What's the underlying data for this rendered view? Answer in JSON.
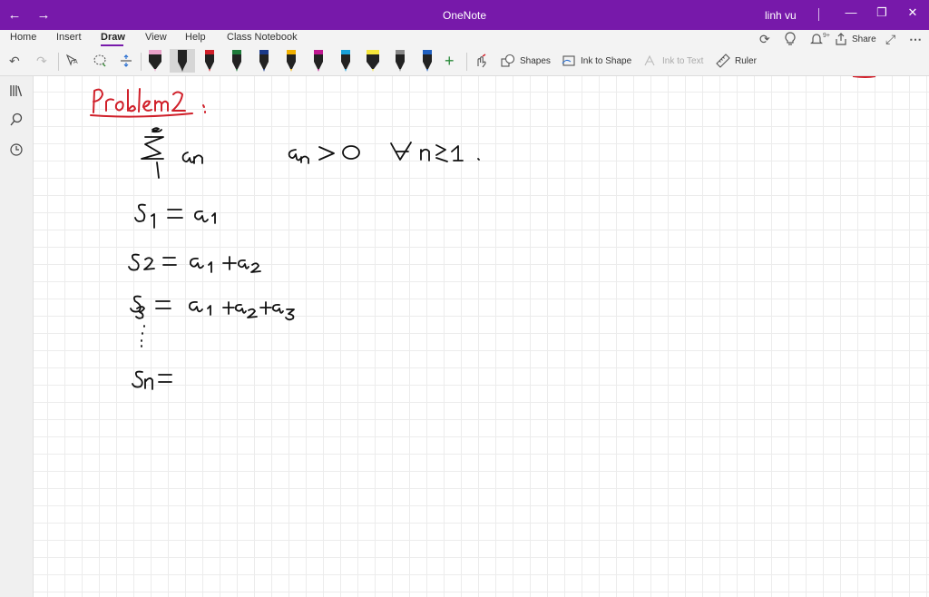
{
  "window": {
    "title": "OneNote",
    "user": "linh vu"
  },
  "ribbon": {
    "tabs": [
      "Home",
      "Insert",
      "Draw",
      "View",
      "Help",
      "Class Notebook"
    ],
    "active_tab": "Draw",
    "tools": {
      "shapes": "Shapes",
      "ink_to_shape": "Ink to Shape",
      "ink_to_text": "Ink to Text",
      "ruler": "Ruler"
    },
    "share": "Share",
    "notifications_count": "9+",
    "pens": [
      {
        "name": "pink-highlighter",
        "color": "#e8a0c8"
      },
      {
        "name": "black-pen",
        "color": "#222222"
      },
      {
        "name": "red-pen",
        "color": "#d0202a"
      },
      {
        "name": "green-pen",
        "color": "#1e7a3a"
      },
      {
        "name": "dark-blue-pen",
        "color": "#1a3a8a"
      },
      {
        "name": "yellow-pen",
        "color": "#f0b000"
      },
      {
        "name": "magenta-pen",
        "color": "#c01890"
      },
      {
        "name": "cyan-pen",
        "color": "#18a0d8"
      },
      {
        "name": "yellow-highlighter",
        "color": "#f5e53a"
      },
      {
        "name": "gray-pen",
        "color": "#888888"
      },
      {
        "name": "blue-pen",
        "color": "#2060c0"
      }
    ]
  },
  "page": {
    "heading": "Problem 2 :",
    "heading_color": "#d0202a",
    "ink_color": "#111111",
    "lines": [
      "Σ (n=1 to ∞) aₙ     aₙ > 0   ∀ n ≥ 1 .",
      "S₁ = a₁",
      "S₂ = a₁ + a₂",
      "S₃ = a₁ + a₂ + a₃",
      "⋮",
      "Sₙ ="
    ]
  }
}
